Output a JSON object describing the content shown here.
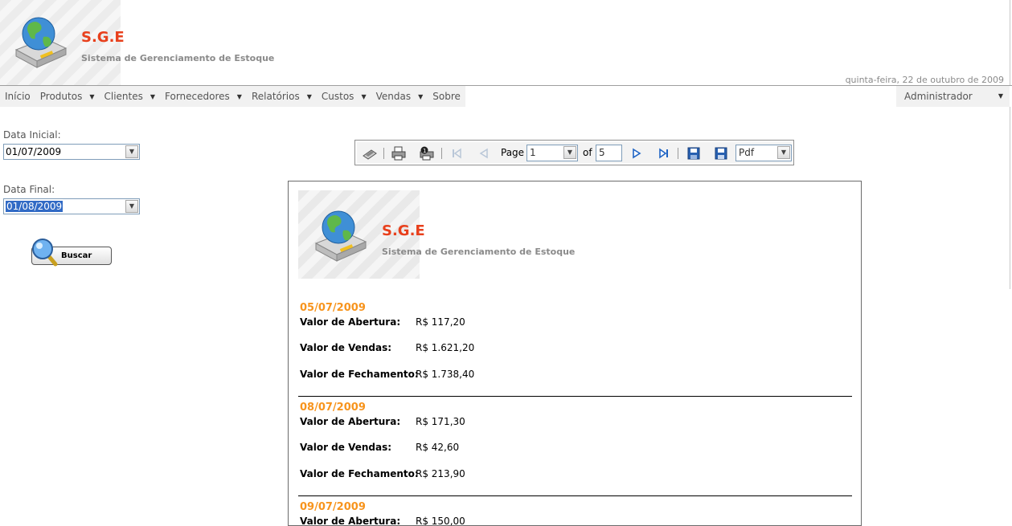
{
  "header": {
    "title": "S.G.E",
    "subtitle": "Sistema de Gerenciamento de Estoque",
    "date": "quinta-feira, 22 de outubro de 2009"
  },
  "menu": {
    "items": [
      {
        "label": "Início",
        "dropdown": false
      },
      {
        "label": "Produtos",
        "dropdown": true
      },
      {
        "label": "Clientes",
        "dropdown": true
      },
      {
        "label": "Fornecedores",
        "dropdown": true
      },
      {
        "label": "Relatórios",
        "dropdown": true
      },
      {
        "label": "Custos",
        "dropdown": true
      },
      {
        "label": "Vendas",
        "dropdown": true
      },
      {
        "label": "Sobre",
        "dropdown": false
      }
    ],
    "user": "Administrador"
  },
  "form": {
    "start_label": "Data Inicial:",
    "start_value": "01/07/2009",
    "end_label": "Data Final:",
    "end_value": "01/08/2009",
    "search_label": "Buscar"
  },
  "toolbar": {
    "page_label": "Page",
    "page_value": "1",
    "of_label": "of",
    "total_pages": "5",
    "format": "Pdf"
  },
  "report": {
    "title": "S.G.E",
    "subtitle": "Sistema de Gerenciamento de Estoque",
    "labels": {
      "opening": "Valor de Abertura:",
      "sales": "Valor de Vendas:",
      "closing": "Valor de Fechamento:"
    },
    "entries": [
      {
        "date": "05/07/2009",
        "opening": "R$ 117,20",
        "sales": "R$ 1.621,20",
        "closing": "R$ 1.738,40"
      },
      {
        "date": "08/07/2009",
        "opening": "R$ 171,30",
        "sales": "R$ 42,60",
        "closing": "R$ 213,90"
      },
      {
        "date": "09/07/2009",
        "opening": "R$ 150,00",
        "sales": "",
        "closing": ""
      }
    ]
  },
  "colors": {
    "brand_red": "#e8401c",
    "date_orange": "#f7941d",
    "menu_bg": "#f1f1f1"
  }
}
